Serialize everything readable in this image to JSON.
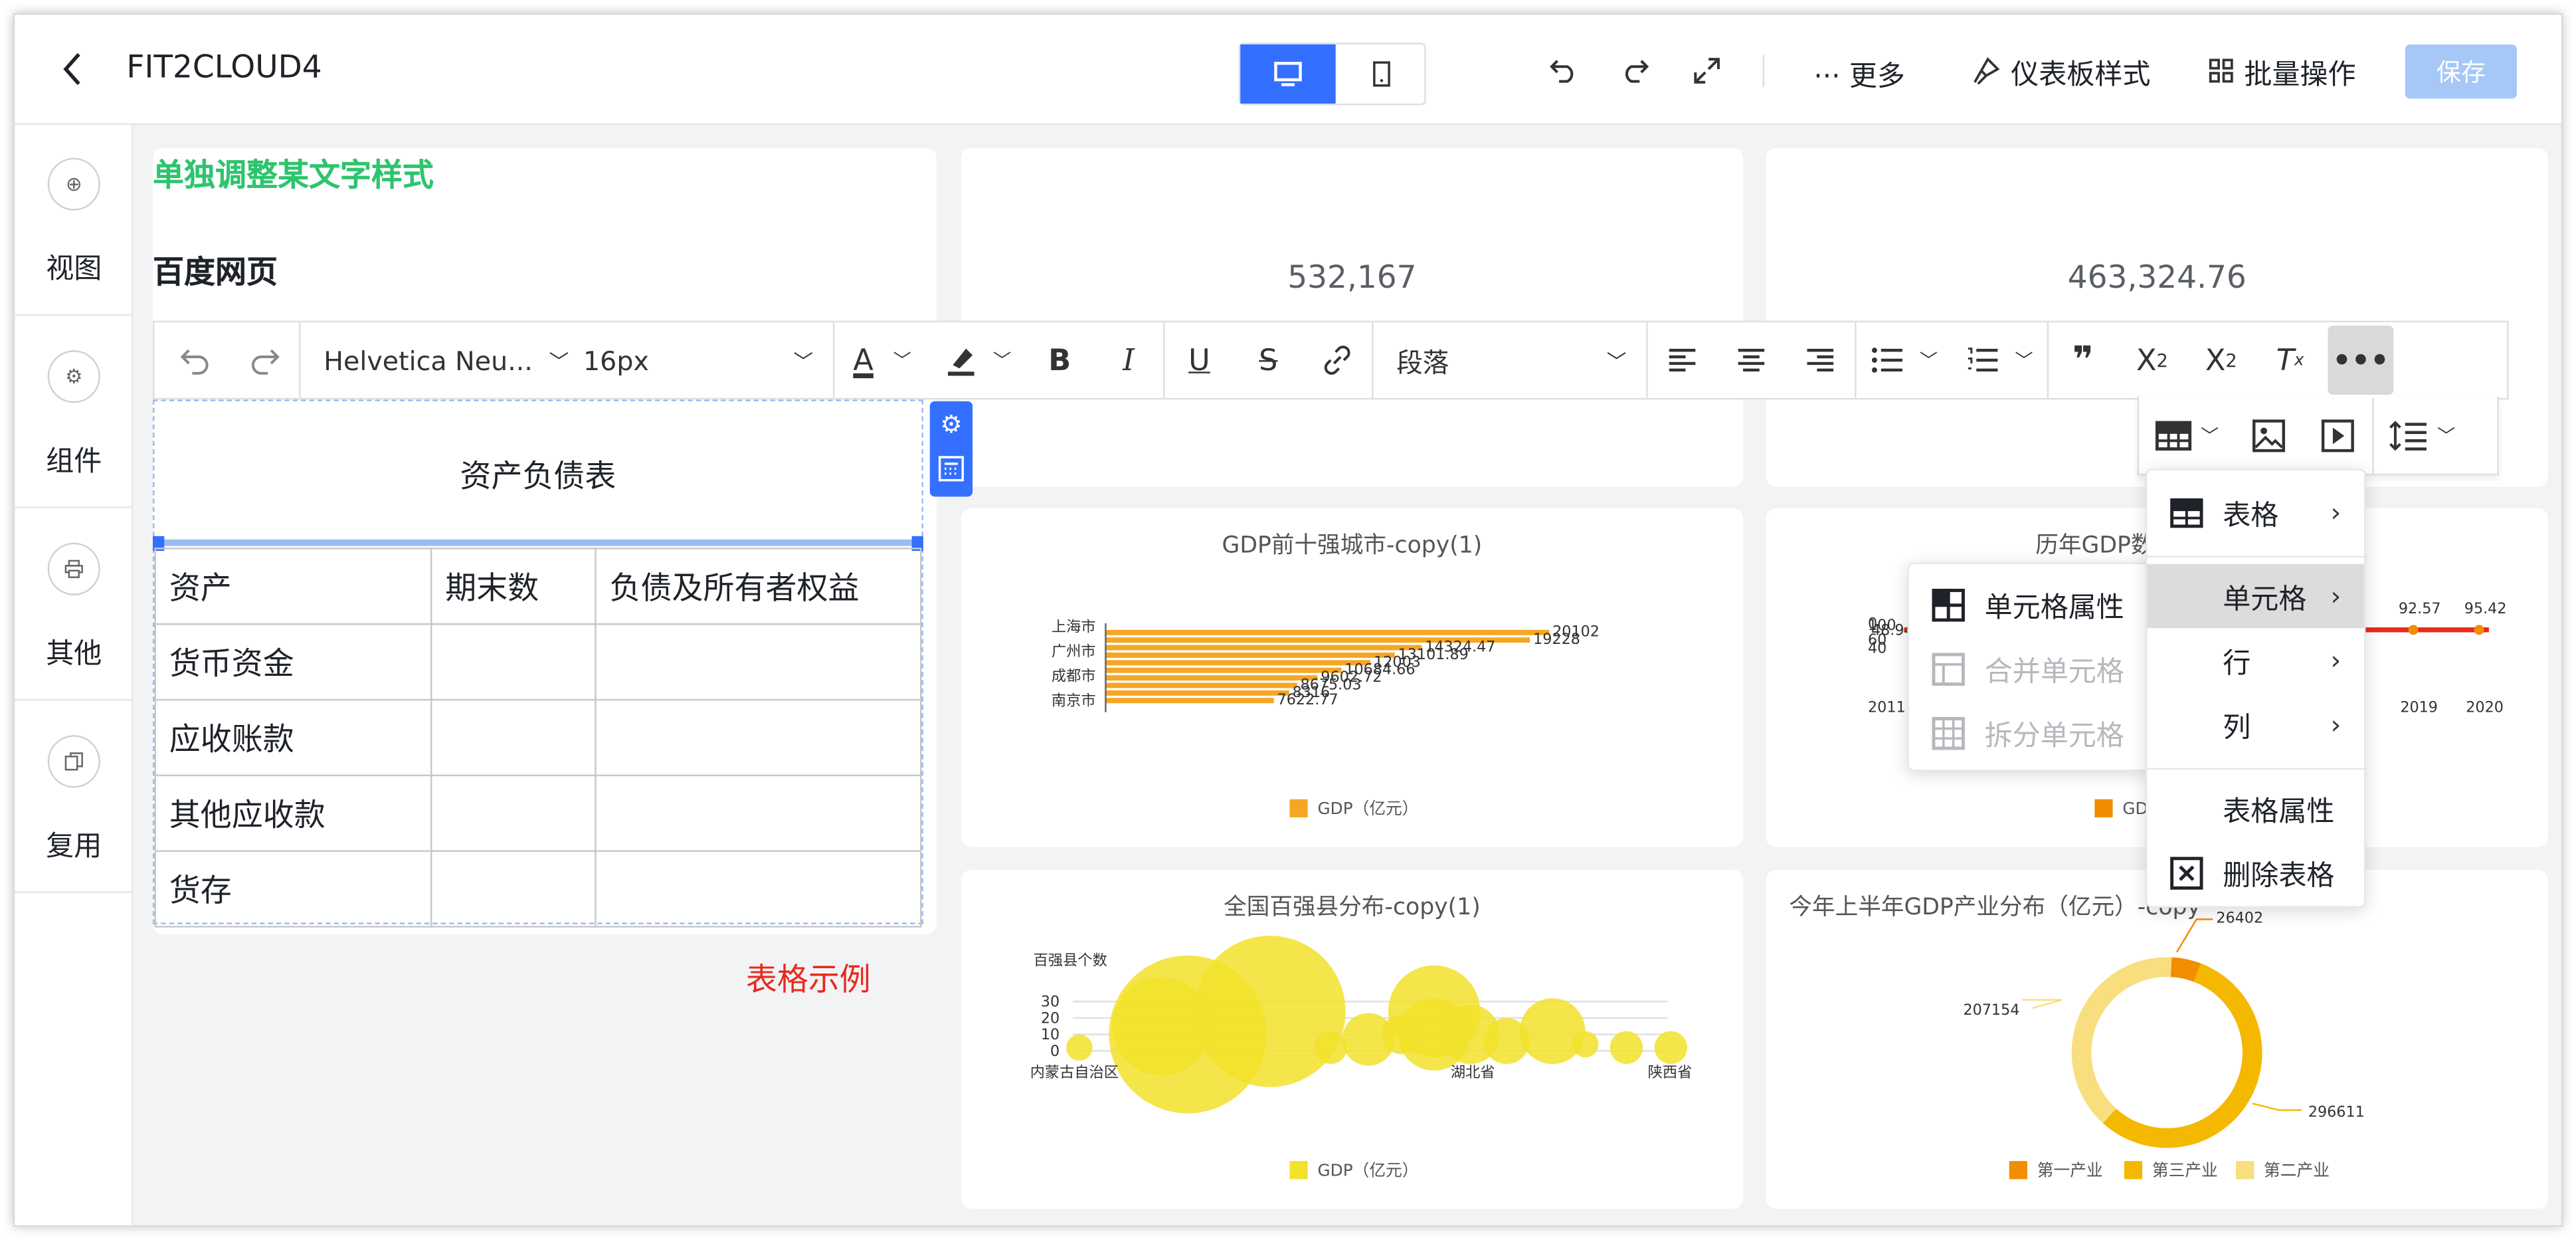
{
  "header": {
    "title": "FIT2CLOUD4",
    "more": "··· 更多",
    "dashboard_style": "仪表板样式",
    "batch_ops": "批量操作",
    "save": "保存"
  },
  "sidebar": {
    "items": [
      {
        "label": "视图",
        "icon": "plus-circle-icon"
      },
      {
        "label": "组件",
        "icon": "gear-icon"
      },
      {
        "label": "其他",
        "icon": "printer-icon"
      },
      {
        "label": "复用",
        "icon": "copy-icon"
      }
    ]
  },
  "rich_text": {
    "styled_heading": "单独调整某文字样式",
    "heading": "百度网页",
    "table_title": "资产负债表",
    "table_rows": [
      [
        "资产",
        "期末数",
        "负债及所有者权益"
      ],
      [
        "货币资金",
        "",
        ""
      ],
      [
        "应收账款",
        "",
        ""
      ],
      [
        "其他应收款",
        "",
        ""
      ],
      [
        "货存",
        "",
        ""
      ]
    ],
    "example_label": "表格示例"
  },
  "editor_toolbar": {
    "font_family": "Helvetica Neu...",
    "font_size": "16px",
    "block_format": "段落"
  },
  "kpi": {
    "value1": "532,167",
    "value2": "463,324.76"
  },
  "table_menu": {
    "items": [
      "表格",
      "单元格",
      "行",
      "列",
      "表格属性",
      "删除表格"
    ]
  },
  "cell_menu": {
    "items": [
      "单元格属性",
      "合并单元格",
      "拆分单元格"
    ]
  },
  "colors": {
    "primary": "#3370ff",
    "save_disabled": "#a6c8f7",
    "orange": "#f5a623",
    "yellow": "#f2e22a",
    "green_text": "#2ec46e",
    "red_text": "#e8291c"
  },
  "chart_data": [
    {
      "type": "bar",
      "title": "GDP前十强城市-copy(1)",
      "categories": [
        "上海市",
        "广州市",
        "成都市",
        "南京市"
      ],
      "data_labels": [
        "20102",
        "19228",
        "14324.47",
        "13101.89",
        "12003",
        "10684.66",
        "9602.72",
        "8675.03",
        "8316",
        "7622.77"
      ],
      "values": [
        20102,
        19228,
        14324.47,
        13101.89,
        12003,
        10684.66,
        9602.72,
        8675.03,
        8316,
        7622.77
      ],
      "legend": [
        "GDP（亿元）"
      ]
    },
    {
      "type": "line",
      "title": "历年GDP数",
      "x": [
        "2011",
        "2019",
        "2020"
      ],
      "ytick": [
        "0",
        "40",
        "60",
        "100"
      ],
      "labels": [
        "48.94",
        "92.57",
        "95.42"
      ],
      "legend": [
        "GDP"
      ]
    },
    {
      "type": "scatter",
      "title": "全国百强县分布-copy(1)",
      "ylabel": "百强县个数",
      "yticks": [
        "0",
        "10",
        "20",
        "30"
      ],
      "x": [
        "内蒙古自治区",
        "湖北省",
        "陕西省"
      ],
      "legend": [
        "GDP（亿元）"
      ]
    },
    {
      "type": "pie",
      "title": "今年上半年GDP产业分布（亿元）-copy",
      "labels": [
        "26402",
        "207154",
        "296611"
      ],
      "legend": [
        "第一产业",
        "第三产业",
        "第二产业"
      ],
      "values": [
        26402,
        296611,
        207154
      ]
    }
  ]
}
